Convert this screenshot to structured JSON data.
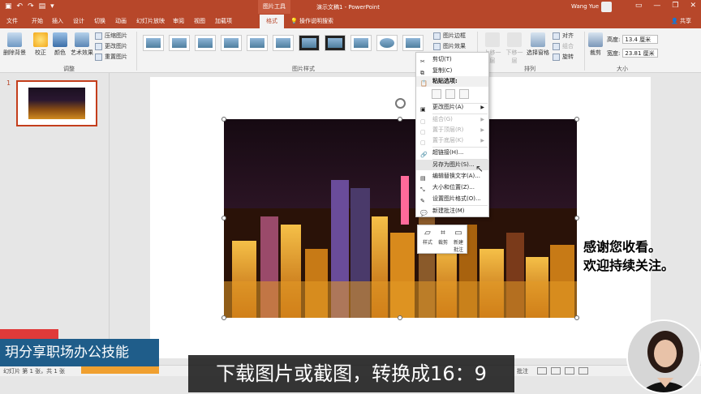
{
  "titlebar": {
    "context_tools": "图片工具",
    "doc_title": "演示文稿1 - PowerPoint",
    "user": "Wang Yue"
  },
  "tabs": [
    "文件",
    "开始",
    "插入",
    "设计",
    "切换",
    "动画",
    "幻灯片放映",
    "审阅",
    "视图",
    "加载项",
    "格式"
  ],
  "tellme": "操作说明搜索",
  "share": "共享",
  "ribbon": {
    "adjust": {
      "remove_bg": "删除背景",
      "correct": "校正",
      "color": "颜色",
      "artistic": "艺术效果",
      "compress": "压缩图片",
      "change": "更改图片",
      "reset": "重置图片",
      "label": "调整"
    },
    "styles": {
      "border": "图片边框",
      "effects": "图片效果",
      "label": "图片样式"
    },
    "arrange": {
      "bring_forward": "上移一层",
      "send_backward": "下移一层",
      "selection_pane": "选择窗格",
      "align": "对齐",
      "group": "组合",
      "rotate": "旋转",
      "label": "排列"
    },
    "size": {
      "crop": "裁剪",
      "height_label": "高度:",
      "height": "13.4 厘米",
      "width_label": "宽度:",
      "width": "23.81 厘米",
      "label": "大小"
    }
  },
  "thumbpane": {
    "slide_number": "1"
  },
  "context_menu": {
    "cut": "剪切(T)",
    "copy": "复制(C)",
    "paste_options": "粘贴选项:",
    "change_picture": "更改图片(A)",
    "group": "组合(G)",
    "bring_to_front": "置于顶层(R)",
    "send_to_back": "置于底层(K)",
    "hyperlink": "超链接(H)...",
    "save_as_picture": "另存为图片(S)...",
    "edit_alt_text": "编辑替换文字(A)...",
    "size_position": "大小和位置(Z)...",
    "format_picture": "设置图片格式(O)...",
    "new_comment": "新建批注(M)"
  },
  "mini_toolbar": {
    "style": "样式",
    "crop": "裁剪",
    "new_comment_1": "新建",
    "new_comment_2": "批注"
  },
  "overlay": {
    "line1": "感谢您收看。",
    "line2": "欢迎持续关注。"
  },
  "statusbar": {
    "slide_info": "幻灯片 第 1 张，共 1 张",
    "comments": "批注"
  },
  "brand": "玥分享职场办公技能",
  "subtitle": "下载图片或截图，转换成16：9"
}
